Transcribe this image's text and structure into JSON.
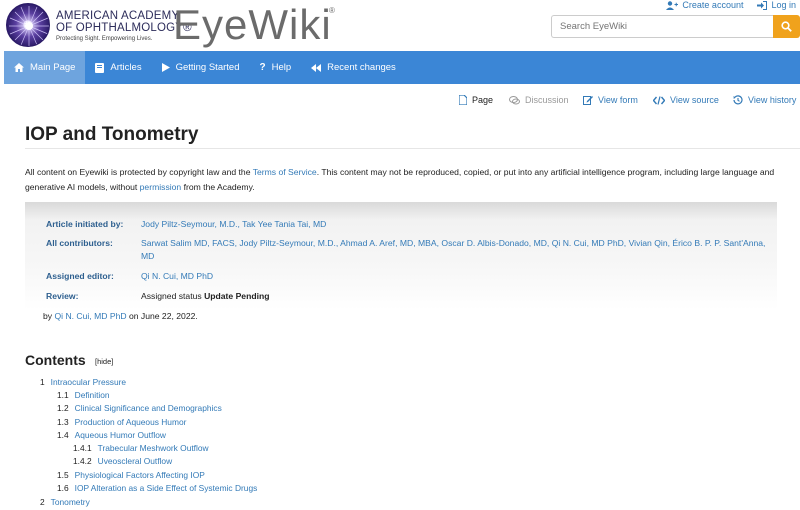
{
  "brand": {
    "org_line1": "AMERICAN ACADEMY",
    "org_line2": "OF OPHTHALMOLOGY®",
    "tagline": "Protecting Sight. Empowering Lives.",
    "site_name": "EyeWiki",
    "site_reg": "®"
  },
  "account": {
    "create": "Create account",
    "login": "Log in"
  },
  "search": {
    "placeholder": "Search EyeWiki"
  },
  "nav": {
    "items": [
      {
        "label": "Main Page",
        "icon": "home-icon"
      },
      {
        "label": "Articles",
        "icon": "book-icon"
      },
      {
        "label": "Getting Started",
        "icon": "play-icon"
      },
      {
        "label": "Help",
        "icon": "question-icon"
      },
      {
        "label": "Recent changes",
        "icon": "rewind-icon"
      }
    ]
  },
  "actions": {
    "page": "Page",
    "discussion": "Discussion",
    "view_form": "View form",
    "view_source": "View source",
    "view_history": "View history"
  },
  "article": {
    "title": "IOP and Tonometry",
    "notice_1": "All content on Eyewiki is protected by copyright law and the ",
    "notice_tos": "Terms of Service",
    "notice_2": ". This content may not be reproduced, copied, or put into any artificial intelligence program, including large language and generative AI models, without ",
    "notice_permission": "permission",
    "notice_3": " from the Academy."
  },
  "info": {
    "initiated_label": "Article initiated by:",
    "initiated_value": "Jody Piltz-Seymour, M.D., Tak Yee Tania Tai, MD",
    "contributors_label": "All contributors:",
    "contributors_value": "Sarwat Salim MD, FACS, Jody Piltz-Seymour, M.D., Ahmad A. Aref, MD, MBA, Oscar D. Albis-Donado, MD, Qi N. Cui, MD PhD, Vivian Qin, Érico B. P. P. Sant'Anna, MD",
    "editor_label": "Assigned editor:",
    "editor_value": "Qi N. Cui, MD PhD",
    "review_label": "Review:",
    "review_prefix": "Assigned status ",
    "review_status": "Update Pending",
    "by_prefix": "by ",
    "by_name": "Qi N. Cui, MD PhD",
    "by_suffix": " on June 22, 2022."
  },
  "toc": {
    "title": "Contents",
    "hide": "[hide]",
    "items": [
      {
        "num": "1",
        "text": "Intraocular Pressure",
        "level": 1
      },
      {
        "num": "1.1",
        "text": "Definition",
        "level": 2
      },
      {
        "num": "1.2",
        "text": "Clinical Significance and Demographics",
        "level": 2
      },
      {
        "num": "1.3",
        "text": "Production of Aqueous Humor",
        "level": 2
      },
      {
        "num": "1.4",
        "text": "Aqueous Humor Outflow",
        "level": 2
      },
      {
        "num": "1.4.1",
        "text": "Trabecular Meshwork Outflow",
        "level": 3
      },
      {
        "num": "1.4.2",
        "text": "Uveoscleral Outflow",
        "level": 3
      },
      {
        "num": "1.5",
        "text": "Physiological Factors Affecting IOP",
        "level": 2
      },
      {
        "num": "1.6",
        "text": "IOP Alteration as a Side Effect of Systemic Drugs",
        "level": 2
      },
      {
        "num": "2",
        "text": "Tonometry",
        "level": 1
      }
    ]
  },
  "colors": {
    "nav_bg": "#3b86d6",
    "nav_active": "#6ea4de",
    "link": "#337ab7",
    "search_button": "#f0a21c"
  }
}
